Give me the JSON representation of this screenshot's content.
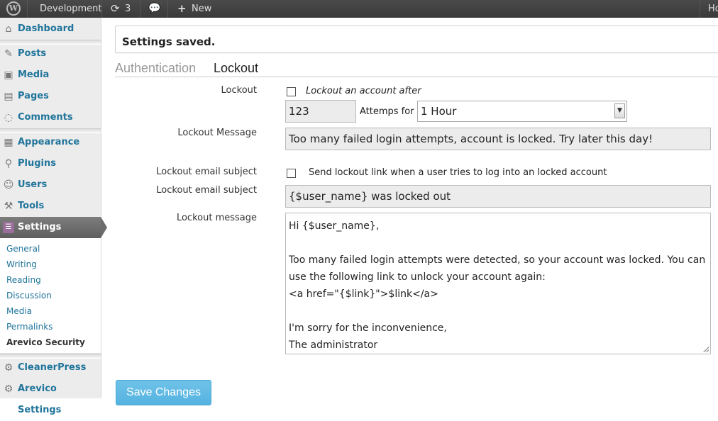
{
  "adminbar": {
    "site_name": "Development",
    "updates_count": "3",
    "new_label": "New",
    "right_label": "Ho"
  },
  "sidebar": {
    "items": [
      {
        "label": "Dashboard",
        "icon": "dashboard-icon"
      },
      {
        "label": "Posts",
        "icon": "pin-icon"
      },
      {
        "label": "Media",
        "icon": "media-icon"
      },
      {
        "label": "Pages",
        "icon": "pages-icon"
      },
      {
        "label": "Comments",
        "icon": "comment-icon"
      },
      {
        "label": "Appearance",
        "icon": "appearance-icon"
      },
      {
        "label": "Plugins",
        "icon": "plug-icon"
      },
      {
        "label": "Users",
        "icon": "users-icon"
      },
      {
        "label": "Tools",
        "icon": "tools-icon"
      },
      {
        "label": "Settings",
        "icon": "settings-icon"
      },
      {
        "label": "CleanerPress",
        "icon": "gear-icon"
      },
      {
        "label": "Arevico Settings",
        "icon": "gear-icon"
      }
    ],
    "submenu": [
      "General",
      "Writing",
      "Reading",
      "Discussion",
      "Media",
      "Permalinks",
      "Arevico Security"
    ]
  },
  "notice": "Settings saved.",
  "tabs": [
    "Authentication",
    "Lockout"
  ],
  "form": {
    "lockout_label": "Lockout",
    "lockout_checkbox_text": "Lockout an account after",
    "attempts_value": "123",
    "attempts_for": "Attemps for",
    "duration_value": "1 Hour",
    "lockout_message_label": "Lockout Message",
    "lockout_message_value": "Too many failed login attempts, account is locked.  Try later this day!",
    "email_subject_label_1": "Lockout email subject",
    "send_link_text": "Send lockout link when a user tries to log into an locked account",
    "email_subject_label_2": "Lockout email subject",
    "email_subject_value": "{$user_name} was locked out",
    "email_message_label": "Lockout message",
    "email_message_value": "Hi {$user_name},\n\nToo many failed login attempts were detected, so your account was locked. You can\nuse the following link to unlock your account again:\n<a href=\"{$link}\">$link</a>\n\nI'm sorry for the inconvenience,\nThe administrator"
  },
  "save_button": "Save Changes",
  "colors": {
    "link": "#21759b",
    "adminbar": "#464646",
    "button": "#5db8e3"
  }
}
